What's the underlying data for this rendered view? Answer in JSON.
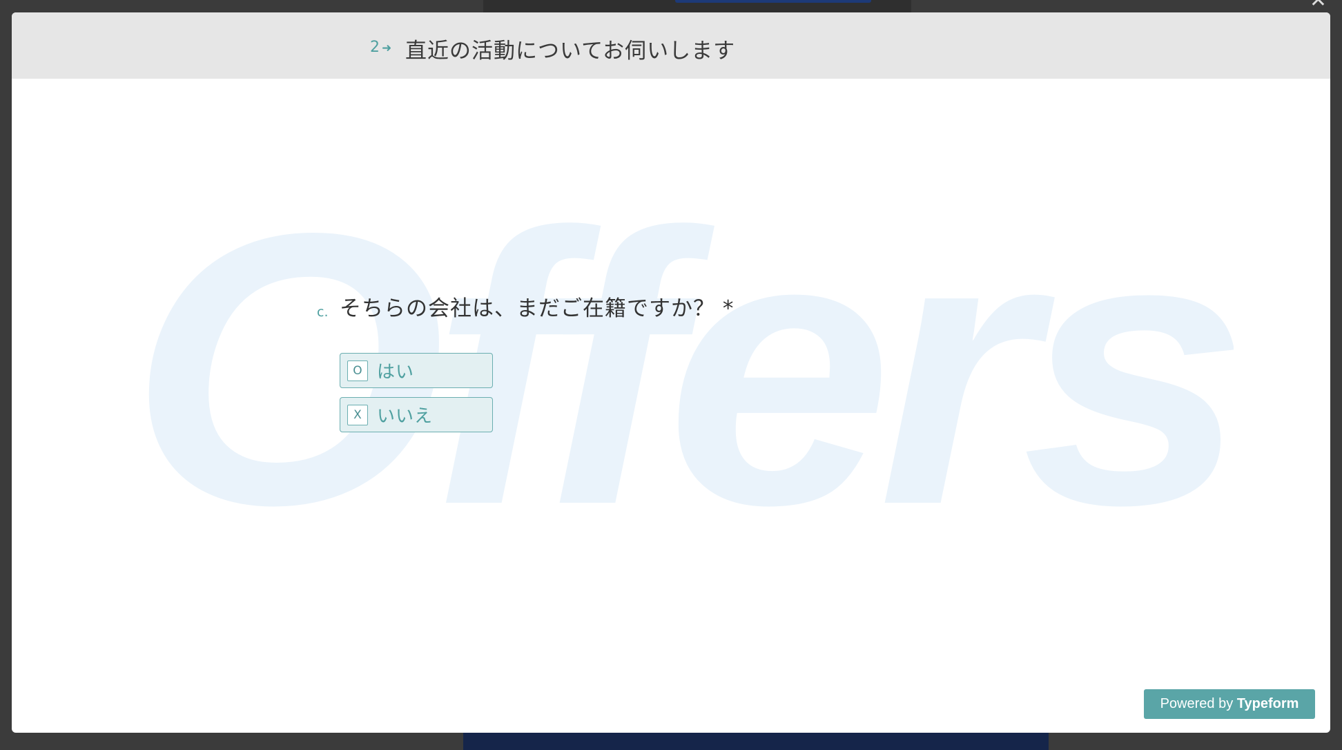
{
  "header": {
    "number": "2",
    "arrow": "➜",
    "title": "直近の活動についてお伺いします"
  },
  "watermark": {
    "text": "Offers",
    "color": "#eaf3fb"
  },
  "question": {
    "label": "c.",
    "text": "そちらの会社は、まだご在籍ですか？ *"
  },
  "choices": [
    {
      "key": "O",
      "label": "はい"
    },
    {
      "key": "X",
      "label": "いいえ"
    }
  ],
  "footer": {
    "powered_prefix": "Powered by ",
    "powered_brand": "Typeform"
  },
  "colors": {
    "accent": "#4fa0a0",
    "choice_bg": "#e3f0f2",
    "header_bg": "#e6e6e6",
    "badge_bg": "#5aa5a7"
  }
}
